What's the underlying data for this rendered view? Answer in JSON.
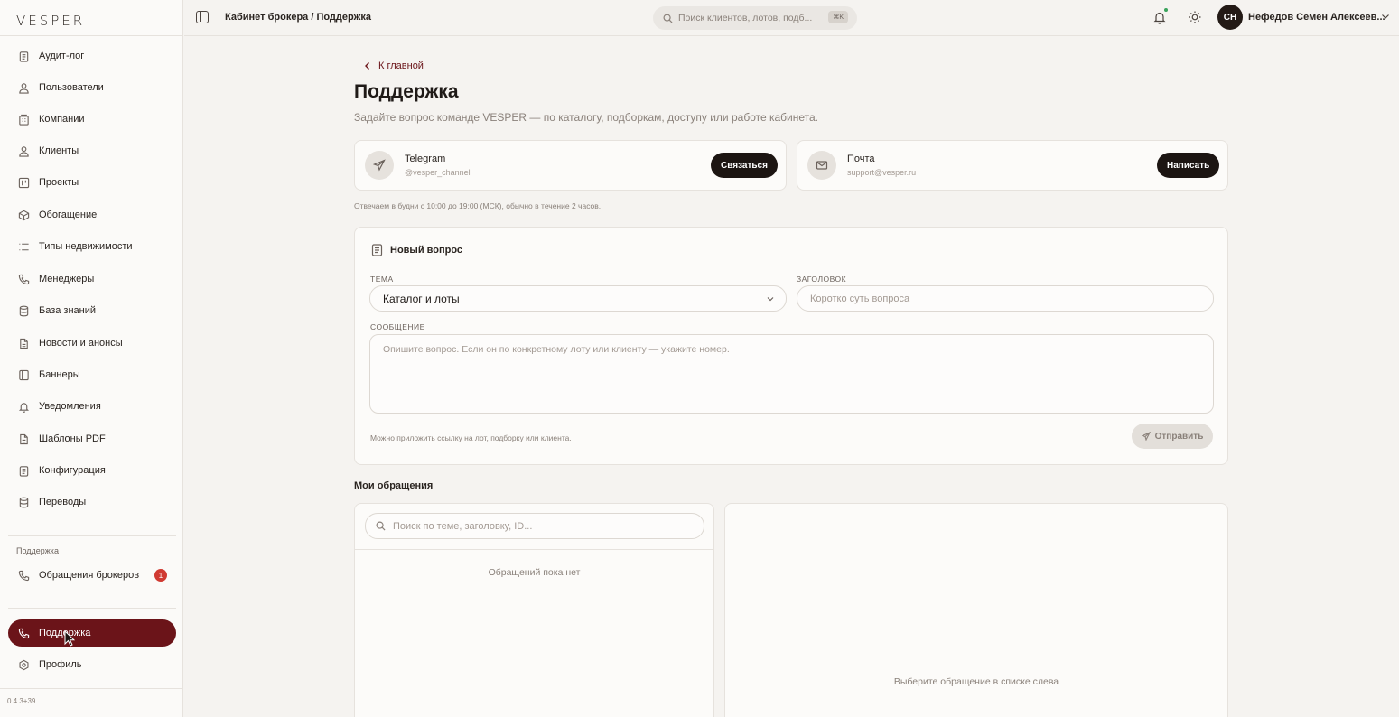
{
  "app": {
    "logo": "VESPER",
    "version": "0.4.3+39"
  },
  "sidebar": {
    "items": [
      {
        "label": "Аудит-лог",
        "icon": "clipboard-icon"
      },
      {
        "label": "Пользователи",
        "icon": "user-icon"
      },
      {
        "label": "Компании",
        "icon": "building-icon"
      },
      {
        "label": "Клиенты",
        "icon": "user-icon"
      },
      {
        "label": "Проекты",
        "icon": "kanban-icon"
      },
      {
        "label": "Обогащение",
        "icon": "box-icon"
      },
      {
        "label": "Типы недвижимости",
        "icon": "list-icon"
      },
      {
        "label": "Менеджеры",
        "icon": "phone-icon"
      },
      {
        "label": "База знаний",
        "icon": "database-icon"
      },
      {
        "label": "Новости и анонсы",
        "icon": "file-icon"
      },
      {
        "label": "Баннеры",
        "icon": "book-icon"
      },
      {
        "label": "Уведомления",
        "icon": "bell-icon"
      },
      {
        "label": "Шаблоны PDF",
        "icon": "file-icon"
      },
      {
        "label": "Конфигурация",
        "icon": "clipboard-icon"
      },
      {
        "label": "Переводы",
        "icon": "database-icon"
      }
    ],
    "support_section": {
      "label": "Поддержка",
      "item": {
        "label": "Обращения брокеров",
        "badge": "1"
      }
    },
    "bottom": [
      {
        "label": "Поддержка",
        "active": true
      },
      {
        "label": "Профиль"
      }
    ]
  },
  "header": {
    "breadcrumb": "Кабинет брокера / Поддержка",
    "search_placeholder": "Поиск клиентов, лотов, подб...",
    "search_shortcut": "⌘K",
    "user_initials": "СН",
    "user_name": "Нефедов Семен Алексеев..."
  },
  "page": {
    "back_label": "К главной",
    "title": "Поддержка",
    "subtitle": "Задайте вопрос команде VESPER — по каталогу, подборкам, доступу или работе кабинета.",
    "contacts": [
      {
        "name": "Telegram",
        "handle": "@vesper_channel",
        "button": "Связаться"
      },
      {
        "name": "Почта",
        "handle": "support@vesper.ru",
        "button": "Написать"
      }
    ],
    "hours_hint": "Отвечаем в будни с 10:00 до 19:00 (МСК), обычно в течение 2 часов."
  },
  "form": {
    "heading": "Новый вопрос",
    "topic_label": "ТЕМА",
    "topic_value": "Каталог и лоты",
    "subject_label": "ЗАГОЛОВОК",
    "subject_placeholder": "Коротко суть вопроса",
    "message_label": "СООБЩЕНИЕ",
    "message_placeholder": "Опишите вопрос. Если он по конкретному лоту или клиенту — укажите номер.",
    "note": "Можно приложить ссылку на лот, подборку или клиента.",
    "submit": "Отправить"
  },
  "tickets": {
    "title": "Мои обращения",
    "search_placeholder": "Поиск по теме, заголовку, ID...",
    "empty_list": "Обращений пока нет",
    "empty_detail": "Выберите обращение в списке слева"
  },
  "colors": {
    "accent": "#6b1419",
    "dark_button": "#1c1512",
    "badge": "#d03a32"
  }
}
